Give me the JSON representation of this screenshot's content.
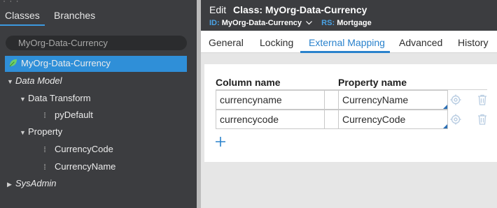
{
  "explorer": {
    "tabs": {
      "classes": "Classes",
      "branches": "Branches"
    },
    "search": {
      "value": "MyOrg-Data-Currency"
    },
    "tree": {
      "root": "MyOrg-Data-Currency",
      "data_model": "Data Model",
      "data_transform": "Data Transform",
      "py_default": "pyDefault",
      "property": "Property",
      "currency_code": "CurrencyCode",
      "currency_name": "CurrencyName",
      "sys_admin": "SysAdmin"
    }
  },
  "header": {
    "edit": "Edit",
    "class_title": "Class: MyOrg-Data-Currency",
    "id_label": "ID:",
    "id_value": "MyOrg-Data-Currency",
    "rs_label": "RS:",
    "rs_value": "Mortgage"
  },
  "form_tabs": {
    "general": "General",
    "locking": "Locking",
    "external_mapping": "External Mapping",
    "advanced": "Advanced",
    "history": "History"
  },
  "mapping": {
    "column_header": "Column name",
    "property_header": "Property name",
    "rows": [
      {
        "column": "currencyname",
        "property": "CurrencyName"
      },
      {
        "column": "currencycode",
        "property": "CurrencyCode"
      }
    ]
  },
  "colors": {
    "accent": "#2a82cc",
    "selection": "#2f8fd8",
    "panel_dark": "#3c3d40"
  },
  "icons": [
    "leaf-icon",
    "chevron-down-icon",
    "chevron-right-icon",
    "drag-handle-icon",
    "settings-icon",
    "trash-icon",
    "add-icon"
  ]
}
